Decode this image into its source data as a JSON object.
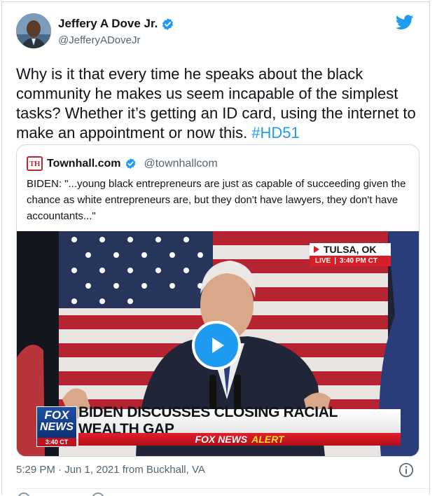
{
  "author": {
    "display_name": "Jeffery A Dove Jr.",
    "handle": "@JefferyADoveJr",
    "verified_icon": "verified-badge-icon"
  },
  "tweet": {
    "text": "Why is it that every time he speaks about the black community he makes us seem incapable of the simplest tasks? Whether it’s getting an ID card, using the internet to make an appointment or now this. ",
    "hashtag": "#HD51"
  },
  "quoted": {
    "logo_text": "TH",
    "name": "Townhall.com",
    "handle": "@townhallcom",
    "text": "BIDEN: \"...young black entrepreneurs are just as capable of succeeding given the chance as white entrepreneurs are, but they don't have lawyers, they don't have accountants...\""
  },
  "video": {
    "location": "TULSA, OK",
    "live_label": "LIVE",
    "live_time": "3:40 PM CT",
    "chyron_logo_line1": "FOX",
    "chyron_logo_line2": "NEWS",
    "chyron_time": "3:40 CT",
    "headline": "BIDEN DISCUSSES CLOSING RACIAL WEALTH GAP",
    "alert_brand": "FOX NEWS",
    "alert_word": "ALERT",
    "play_icon": "play-icon"
  },
  "meta": {
    "timestamp": "5:29 PM · Jun 1, 2021 from Buckhall, VA"
  },
  "colors": {
    "accent": "#1d9bf0",
    "fox_red": "#d61f26",
    "fox_blue": "#1d4fa6"
  }
}
